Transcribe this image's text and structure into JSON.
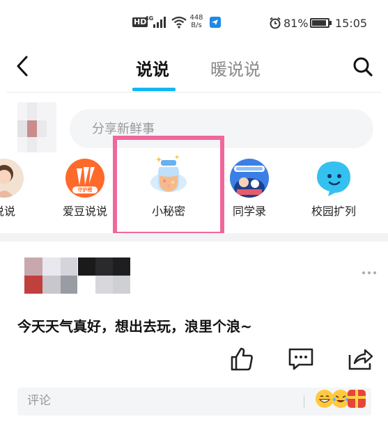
{
  "status_bar": {
    "hd": "HD",
    "network": "4G",
    "speed_value": "448",
    "speed_unit": "B/s",
    "battery_pct": "81%",
    "time": "15:05"
  },
  "nav": {
    "tabs": [
      {
        "label": "说说",
        "active": true
      },
      {
        "label": "暖说说",
        "active": false
      }
    ]
  },
  "composer": {
    "placeholder": "分享新鲜事"
  },
  "shortcuts": [
    {
      "label": "说说"
    },
    {
      "label": "爱豆说说",
      "badge": "守护榜"
    },
    {
      "label": "小秘密"
    },
    {
      "label": "同学录"
    },
    {
      "label": "校园扩列"
    }
  ],
  "post": {
    "text": "今天天气真好，想出去玩，浪里个浪~"
  },
  "comment": {
    "placeholder": "评论"
  },
  "colors": {
    "accent": "#12b7f5",
    "highlight": "#f0679b"
  }
}
